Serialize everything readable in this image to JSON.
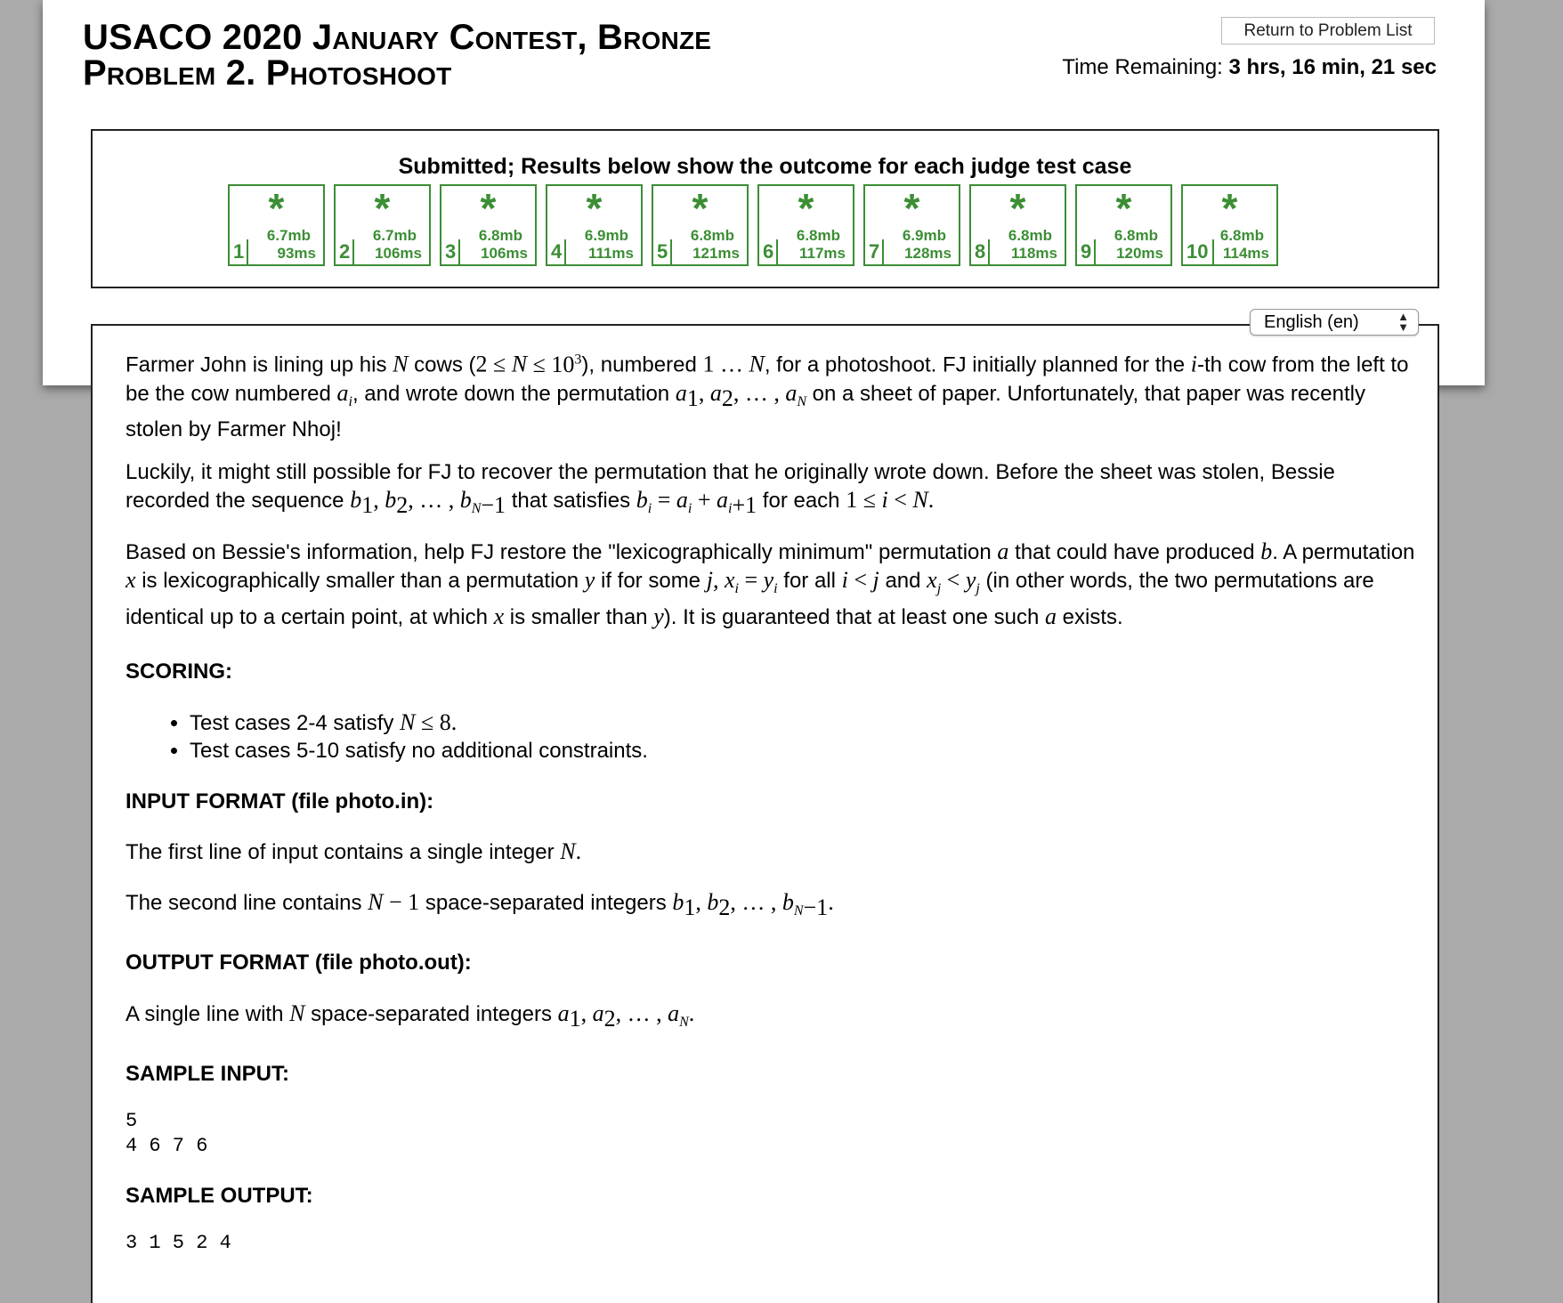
{
  "header": {
    "title_line1": "USACO 2020 January Contest, Bronze",
    "title_line2": "Problem 2. Photoshoot",
    "return_button": "Return to Problem List",
    "time_label": "Time Remaining:",
    "time_value": "3 hrs, 16 min, 21 sec"
  },
  "results": {
    "title": "Submitted; Results below show the outcome for each judge test case",
    "cases": [
      {
        "num": "1",
        "mark": "*",
        "mem": "6.7mb",
        "time": "93ms"
      },
      {
        "num": "2",
        "mark": "*",
        "mem": "6.7mb",
        "time": "106ms"
      },
      {
        "num": "3",
        "mark": "*",
        "mem": "6.8mb",
        "time": "106ms"
      },
      {
        "num": "4",
        "mark": "*",
        "mem": "6.9mb",
        "time": "111ms"
      },
      {
        "num": "5",
        "mark": "*",
        "mem": "6.8mb",
        "time": "121ms"
      },
      {
        "num": "6",
        "mark": "*",
        "mem": "6.8mb",
        "time": "117ms"
      },
      {
        "num": "7",
        "mark": "*",
        "mem": "6.9mb",
        "time": "128ms"
      },
      {
        "num": "8",
        "mark": "*",
        "mem": "6.8mb",
        "time": "118ms"
      },
      {
        "num": "9",
        "mark": "*",
        "mem": "6.8mb",
        "time": "120ms"
      },
      {
        "num": "10",
        "mark": "*",
        "mem": "6.8mb",
        "time": "114ms"
      }
    ],
    "case_color": "#3c8e35"
  },
  "language": {
    "selected": "English (en)"
  },
  "statement": {
    "p1_a": "Farmer John is lining up his ",
    "p1_b": " cows (",
    "p1_c": "), numbered ",
    "p1_d": ", for a photoshoot. FJ initially planned for the ",
    "p1_e": "-th cow from the left to be the cow numbered ",
    "p1_f": ", and wrote down the permutation ",
    "p1_g": " on a sheet of paper. Unfortunately, that paper was recently stolen by Farmer Nhoj!",
    "p2_a": "Luckily, it might still possible for FJ to recover the permutation that he originally wrote down. Before the sheet was stolen, Bessie recorded the sequence ",
    "p2_b": " that satisfies ",
    "p2_c": " for each ",
    "p3_a": "Based on Bessie's information, help FJ restore the \"lexicographically minimum\" permutation ",
    "p3_b": " that could have produced ",
    "p3_c": ". A permutation ",
    "p3_d": " is lexicographically smaller than a permutation ",
    "p3_e": " if for some ",
    "p3_f": " for all ",
    "p3_g": " and ",
    "p3_h": " (in other words, the two permutations are identical up to a certain point, at which ",
    "p3_i": " is smaller than ",
    "p3_j": "). It is guaranteed that at least one such ",
    "p3_k": " exists.",
    "scoring_heading": "SCORING:",
    "scoring_1": "Test cases 2-4 satisfy ",
    "scoring_2": "Test cases 5-10 satisfy no additional constraints.",
    "input_heading": "INPUT FORMAT (file photo.in):",
    "input_1": "The first line of input contains a single integer ",
    "input_2a": "The second line contains ",
    "input_2b": " space-separated integers ",
    "output_heading": "OUTPUT FORMAT (file photo.out):",
    "output_1a": "A single line with ",
    "output_1b": " space-separated integers ",
    "sample_input_heading": "SAMPLE INPUT:",
    "sample_input": "5\n4 6 7 6",
    "sample_output_heading": "SAMPLE OUTPUT:",
    "sample_output": "3 1 5 2 4"
  }
}
